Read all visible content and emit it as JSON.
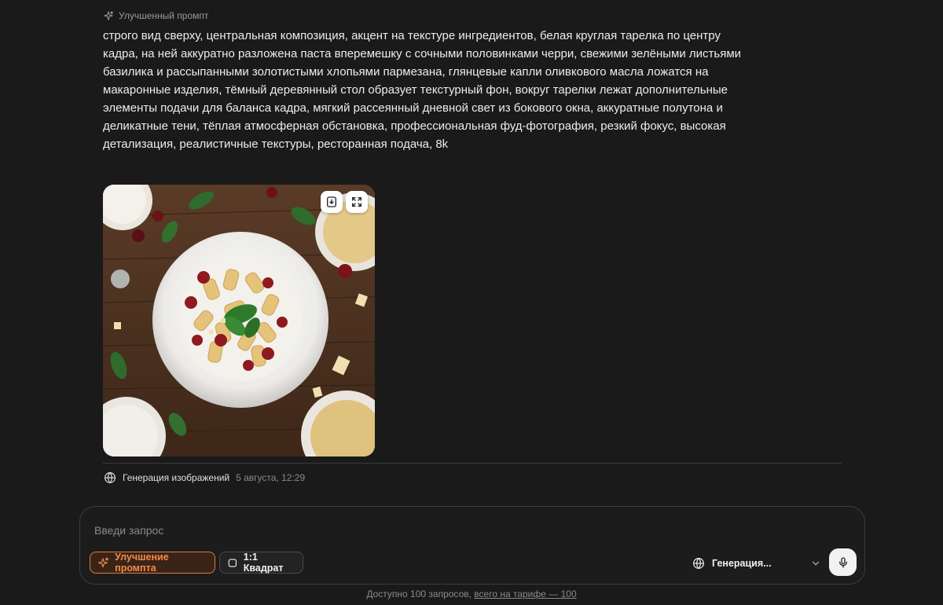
{
  "message": {
    "enhanced_label": "Улучшенный промпт",
    "prompt_text": "строго вид сверху, центральная композиция, акцент на текстуре ингредиентов, белая круглая тарелка по центру кадра, на ней аккуратно разложена паста вперемешку с сочными половинками черри, свежими зелёными листьями базилика и рассыпанными золотистыми хлопьями пармезана, глянцевые капли оливкового масла ложатся на макаронные изделия, тёмный деревянный стол образует текстурный фон, вокруг тарелки лежат дополнительные элементы подачи для баланса кадра, мягкий рассеянный дневной свет из бокового окна, аккуратные полутона и деликатные тени, тёплая атмосферная обстановка, профессиональная фуд-фотография, резкий фокус, высокая детализация, реалистичные текстуры, ресторанная подача, 8k",
    "model_name": "Генерация изображений",
    "timestamp": "5 августа, 12:29"
  },
  "composer": {
    "placeholder": "Введи запрос",
    "enhance_label": "Улучшение промпта",
    "ratio_label": "1:1 Квадрат",
    "model_label": "Генерация..."
  },
  "footer": {
    "available": "Доступно 100 запросов, ",
    "tariff_link": "всего на тарифе — 100"
  },
  "colors": {
    "accent": "#f28a48",
    "background": "#1a1a1a"
  }
}
